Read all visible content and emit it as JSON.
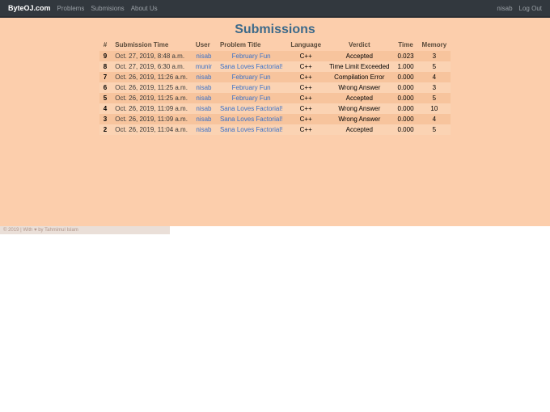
{
  "nav": {
    "brand": "ByteOJ.com",
    "links": [
      "Problems",
      "Submisions",
      "About Us"
    ],
    "user": "nisab",
    "logout": "Log Out"
  },
  "page": {
    "title": "Submissions"
  },
  "headers": {
    "num": "#",
    "time": "Submission Time",
    "user": "User",
    "problem": "Problem Title",
    "lang": "Language",
    "verdict": "Verdict",
    "t": "Time",
    "mem": "Memory"
  },
  "rows": [
    {
      "num": "9",
      "time": "Oct. 27, 2019, 8:48 a.m.",
      "user": "nisab",
      "problem": "February Fun",
      "lang": "C++",
      "verdict": "Accepted",
      "t": "0.023",
      "mem": "3"
    },
    {
      "num": "8",
      "time": "Oct. 27, 2019, 6:30 a.m.",
      "user": "munir",
      "problem": "Sana Loves Factorial!",
      "lang": "C++",
      "verdict": "Time Limit Exceeded",
      "t": "1.000",
      "mem": "5"
    },
    {
      "num": "7",
      "time": "Oct. 26, 2019, 11:26 a.m.",
      "user": "nisab",
      "problem": "February Fun",
      "lang": "C++",
      "verdict": "Compilation Error",
      "t": "0.000",
      "mem": "4"
    },
    {
      "num": "6",
      "time": "Oct. 26, 2019, 11:25 a.m.",
      "user": "nisab",
      "problem": "February Fun",
      "lang": "C++",
      "verdict": "Wrong Answer",
      "t": "0.000",
      "mem": "3"
    },
    {
      "num": "5",
      "time": "Oct. 26, 2019, 11:25 a.m.",
      "user": "nisab",
      "problem": "February Fun",
      "lang": "C++",
      "verdict": "Accepted",
      "t": "0.000",
      "mem": "5"
    },
    {
      "num": "4",
      "time": "Oct. 26, 2019, 11:09 a.m.",
      "user": "nisab",
      "problem": "Sana Loves Factorial!",
      "lang": "C++",
      "verdict": "Wrong Answer",
      "t": "0.000",
      "mem": "10"
    },
    {
      "num": "3",
      "time": "Oct. 26, 2019, 11:09 a.m.",
      "user": "nisab",
      "problem": "Sana Loves Factorial!",
      "lang": "C++",
      "verdict": "Wrong Answer",
      "t": "0.000",
      "mem": "4"
    },
    {
      "num": "2",
      "time": "Oct. 26, 2019, 11:04 a.m.",
      "user": "nisab",
      "problem": "Sana Loves Factorial!",
      "lang": "C++",
      "verdict": "Accepted",
      "t": "0.000",
      "mem": "5"
    }
  ],
  "footer": "© 2019 | With ♥ by Tahmimul Islam"
}
